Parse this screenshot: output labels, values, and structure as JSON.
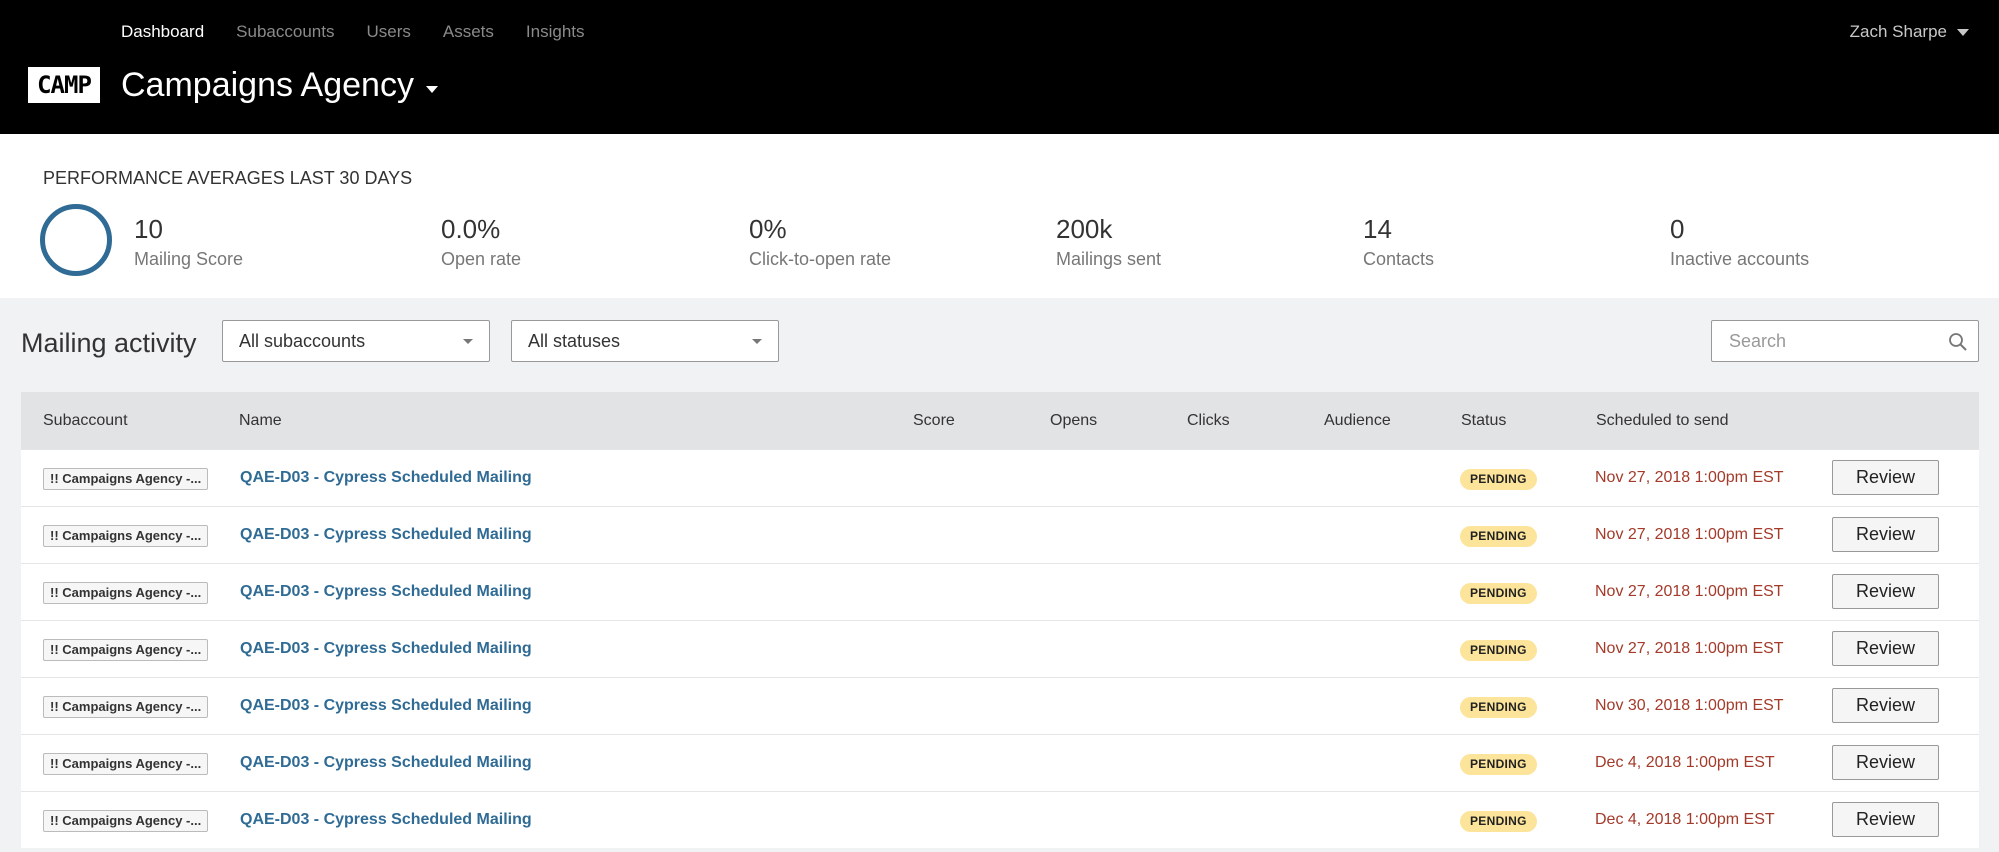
{
  "nav": {
    "items": [
      {
        "label": "Dashboard",
        "active": true
      },
      {
        "label": "Subaccounts",
        "active": false
      },
      {
        "label": "Users",
        "active": false
      },
      {
        "label": "Assets",
        "active": false
      },
      {
        "label": "Insights",
        "active": false
      }
    ],
    "user_name": "Zach Sharpe"
  },
  "brand": {
    "logo_text": "CAMP",
    "agency_name": "Campaigns Agency"
  },
  "performance": {
    "heading": "PERFORMANCE AVERAGES",
    "period": "LAST 30 DAYS",
    "metrics": [
      {
        "value": "10",
        "label": "Mailing Score"
      },
      {
        "value": "0.0%",
        "label": "Open rate"
      },
      {
        "value": "0%",
        "label": "Click-to-open rate"
      },
      {
        "value": "200k",
        "label": "Mailings sent"
      },
      {
        "value": "14",
        "label": "Contacts"
      },
      {
        "value": "0",
        "label": "Inactive accounts"
      }
    ]
  },
  "activity": {
    "title": "Mailing activity",
    "subaccount_filter": "All subaccounts",
    "status_filter": "All statuses",
    "search_placeholder": "Search"
  },
  "table": {
    "columns": [
      "Subaccount",
      "Name",
      "Score",
      "Opens",
      "Clicks",
      "Audience",
      "Status",
      "Scheduled to send"
    ],
    "review_label": "Review",
    "rows": [
      {
        "subaccount": "!! Campaigns Agency -...",
        "name": "QAE-D03 - Cypress Scheduled Mailing",
        "status": "PENDING",
        "scheduled": "Nov 27, 2018 1:00pm EST"
      },
      {
        "subaccount": "!! Campaigns Agency -...",
        "name": "QAE-D03 - Cypress Scheduled Mailing",
        "status": "PENDING",
        "scheduled": "Nov 27, 2018 1:00pm EST"
      },
      {
        "subaccount": "!! Campaigns Agency -...",
        "name": "QAE-D03 - Cypress Scheduled Mailing",
        "status": "PENDING",
        "scheduled": "Nov 27, 2018 1:00pm EST"
      },
      {
        "subaccount": "!! Campaigns Agency -...",
        "name": "QAE-D03 - Cypress Scheduled Mailing",
        "status": "PENDING",
        "scheduled": "Nov 27, 2018 1:00pm EST"
      },
      {
        "subaccount": "!! Campaigns Agency -...",
        "name": "QAE-D03 - Cypress Scheduled Mailing",
        "status": "PENDING",
        "scheduled": "Nov 30, 2018 1:00pm EST"
      },
      {
        "subaccount": "!! Campaigns Agency -...",
        "name": "QAE-D03 - Cypress Scheduled Mailing",
        "status": "PENDING",
        "scheduled": "Dec 4, 2018 1:00pm EST"
      },
      {
        "subaccount": "!! Campaigns Agency -...",
        "name": "QAE-D03 - Cypress Scheduled Mailing",
        "status": "PENDING",
        "scheduled": "Dec 4, 2018 1:00pm EST"
      }
    ]
  },
  "colors": {
    "header_bg": "#000000",
    "accent": "#2f6b94",
    "pending_badge": "#fce49a",
    "scheduled_text": "#a33a2a"
  }
}
